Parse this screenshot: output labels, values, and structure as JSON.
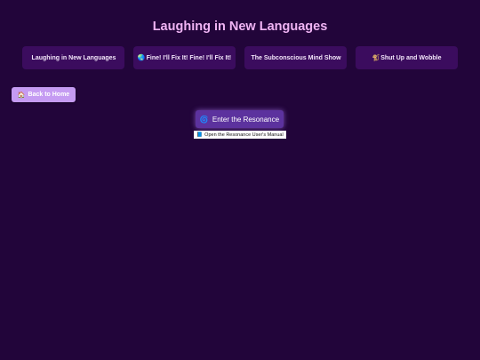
{
  "header": {
    "title": "Laughing in New Languages"
  },
  "nav": {
    "items": [
      {
        "icon": "",
        "label": "Laughing in New Languages"
      },
      {
        "icon": "🌏",
        "label": "Fine! I'll Fix It! Fine! I'll Fix It!"
      },
      {
        "icon": "",
        "label": "The Subconscious Mind Show"
      },
      {
        "icon": "🐒",
        "label": "Shut Up and Wobble"
      }
    ]
  },
  "home_button": {
    "icon": "🏠",
    "label": "Back to Home"
  },
  "enter_button": {
    "icon": "🌀",
    "label": "Enter the Resonance"
  },
  "manual_link": {
    "icon": "📘",
    "label": "Open the Resonance User's Manual"
  },
  "colors": {
    "background": "#22053a",
    "title": "#f0b4f4",
    "card": "#3b0c5e",
    "home_button": "#c59bf2",
    "enter_button": "#5c329e"
  }
}
